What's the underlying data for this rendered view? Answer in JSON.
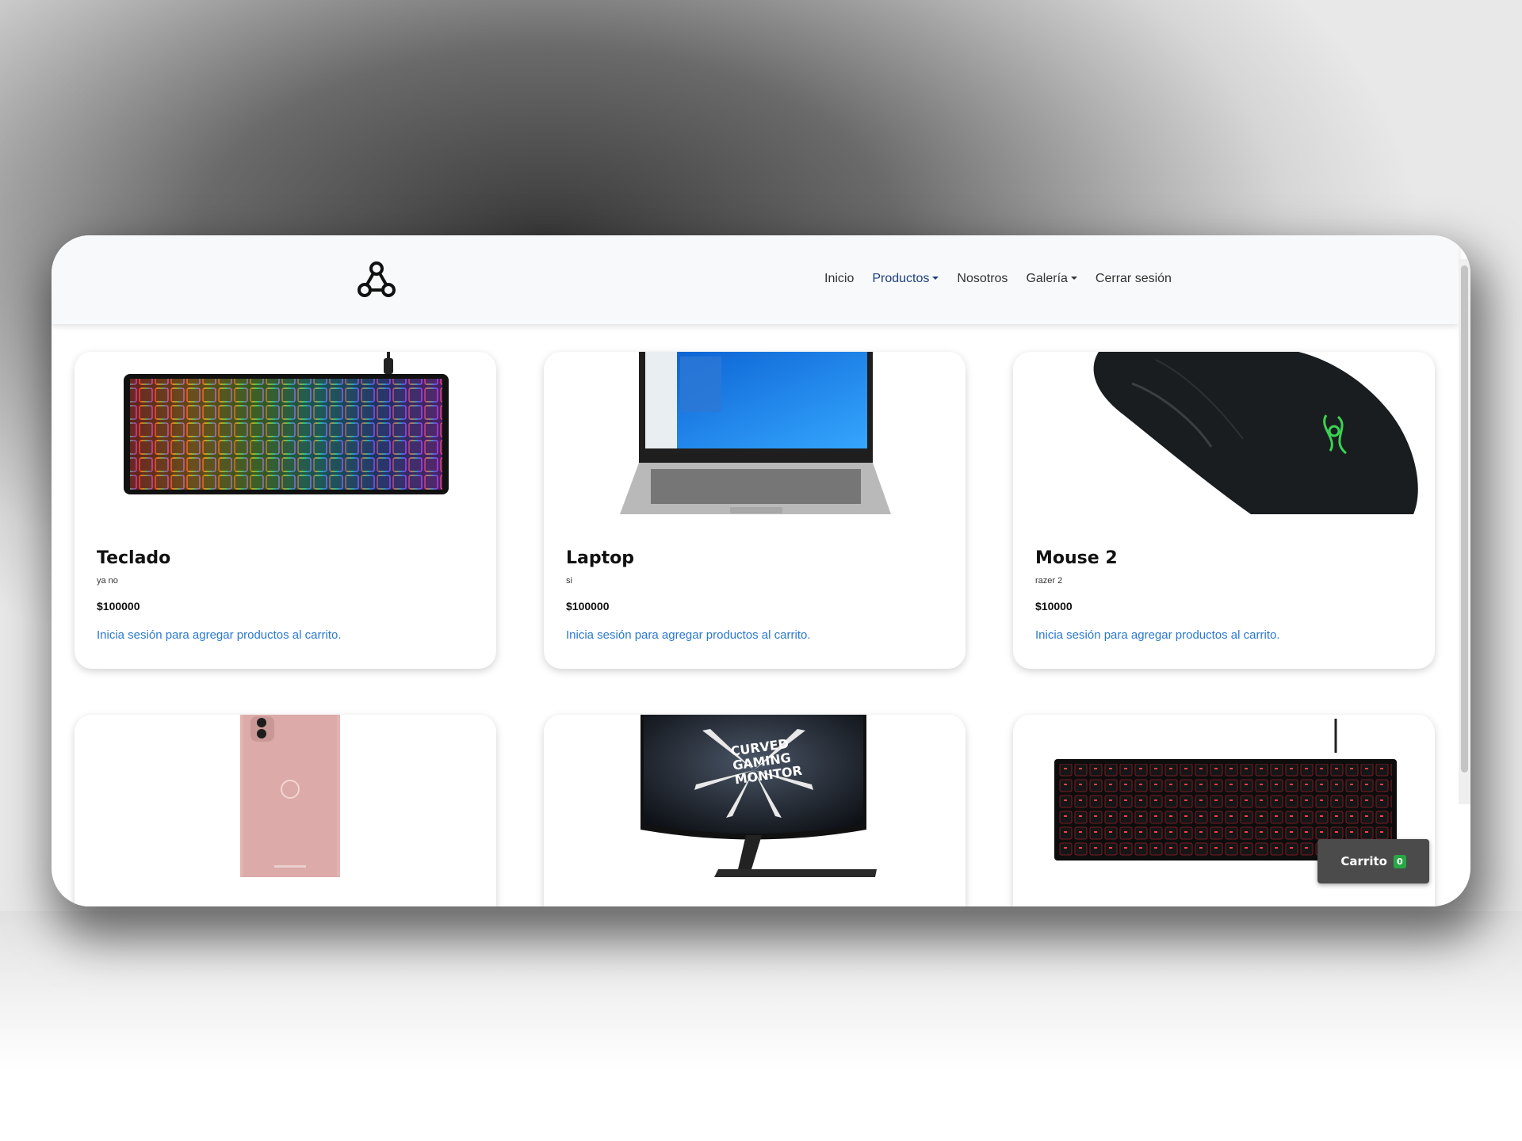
{
  "navbar": {
    "logo_icon": "nodes-logo-icon",
    "items": [
      {
        "label": "Inicio",
        "dropdown": false,
        "active": false
      },
      {
        "label": "Productos",
        "dropdown": true,
        "active": true
      },
      {
        "label": "Nosotros",
        "dropdown": false,
        "active": false
      },
      {
        "label": "Galería",
        "dropdown": true,
        "active": false
      },
      {
        "label": "Cerrar sesión",
        "dropdown": false,
        "active": false
      }
    ]
  },
  "products": [
    {
      "title": "Teclado",
      "description": "ya no",
      "price": "$100000",
      "link": "Inicia sesión para agregar productos al carrito.",
      "image": "rgb-keyboard-image"
    },
    {
      "title": "Laptop",
      "description": "si",
      "price": "$100000",
      "link": "Inicia sesión para agregar productos al carrito.",
      "image": "laptop-image"
    },
    {
      "title": "Mouse 2",
      "description": "razer 2",
      "price": "$10000",
      "link": "Inicia sesión para agregar productos al carrito.",
      "image": "razer-mouse-image"
    },
    {
      "image": "pink-phone-image"
    },
    {
      "image": "curved-monitor-image",
      "image_text": [
        "CURVED",
        "GAMING",
        "MONITOR"
      ]
    },
    {
      "image": "red-keyboard-image"
    }
  ],
  "cart": {
    "label": "Carrito",
    "count": "0"
  },
  "colors": {
    "link": "#2a78d4",
    "badge": "#28a745",
    "active_nav": "#1c3f7c"
  }
}
